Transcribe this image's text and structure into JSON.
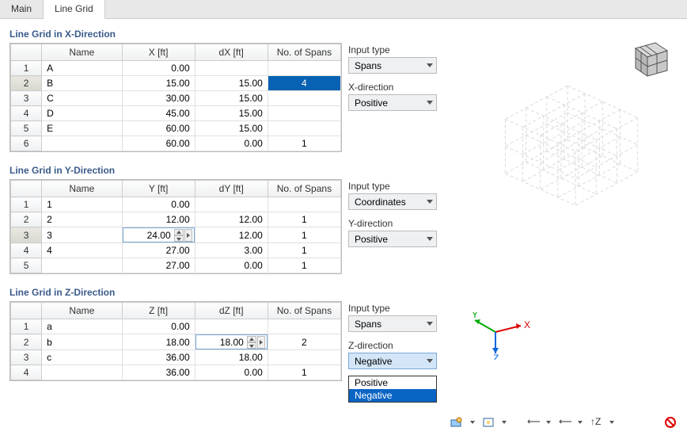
{
  "tabs": {
    "main": "Main",
    "linegrid": "Line Grid"
  },
  "sections": {
    "x": {
      "title": "Line Grid in X-Direction",
      "cols": [
        "Name",
        "X [ft]",
        "dX [ft]",
        "No. of Spans"
      ],
      "rows": [
        {
          "n": "1",
          "name": "A",
          "v": "0.00",
          "d": "",
          "s": ""
        },
        {
          "n": "2",
          "name": "B",
          "v": "15.00",
          "d": "15.00",
          "s": "4",
          "sel": true
        },
        {
          "n": "3",
          "name": "C",
          "v": "30.00",
          "d": "15.00",
          "s": ""
        },
        {
          "n": "4",
          "name": "D",
          "v": "45.00",
          "d": "15.00",
          "s": ""
        },
        {
          "n": "5",
          "name": "E",
          "v": "60.00",
          "d": "15.00",
          "s": ""
        },
        {
          "n": "6",
          "name": "",
          "v": "60.00",
          "d": "0.00",
          "s": "1"
        }
      ],
      "opts": {
        "input_lbl": "Input type",
        "input_val": "Spans",
        "dir_lbl": "X-direction",
        "dir_val": "Positive"
      }
    },
    "y": {
      "title": "Line Grid in Y-Direction",
      "cols": [
        "Name",
        "Y [ft]",
        "dY [ft]",
        "No. of Spans"
      ],
      "rows": [
        {
          "n": "1",
          "name": "1",
          "v": "0.00",
          "d": "",
          "s": ""
        },
        {
          "n": "2",
          "name": "2",
          "v": "12.00",
          "d": "12.00",
          "s": "1"
        },
        {
          "n": "3",
          "name": "3",
          "v": "24.00",
          "d": "12.00",
          "s": "1",
          "spin": true
        },
        {
          "n": "4",
          "name": "4",
          "v": "27.00",
          "d": "3.00",
          "s": "1"
        },
        {
          "n": "5",
          "name": "",
          "v": "27.00",
          "d": "0.00",
          "s": "1"
        }
      ],
      "opts": {
        "input_lbl": "Input type",
        "input_val": "Coordinates",
        "dir_lbl": "Y-direction",
        "dir_val": "Positive"
      }
    },
    "z": {
      "title": "Line Grid in Z-Direction",
      "cols": [
        "Name",
        "Z [ft]",
        "dZ [ft]",
        "No. of Spans"
      ],
      "rows": [
        {
          "n": "1",
          "name": "a",
          "v": "0.00",
          "d": "",
          "s": ""
        },
        {
          "n": "2",
          "name": "b",
          "v": "18.00",
          "d": "18.00",
          "s": "2",
          "spin_d": true
        },
        {
          "n": "3",
          "name": "c",
          "v": "36.00",
          "d": "18.00",
          "s": ""
        },
        {
          "n": "4",
          "name": "",
          "v": "36.00",
          "d": "0.00",
          "s": "1"
        }
      ],
      "opts": {
        "input_lbl": "Input type",
        "input_val": "Spans",
        "dir_lbl": "Z-direction",
        "dir_val": "Negative",
        "open": true,
        "options": [
          "Positive",
          "Negative"
        ]
      }
    }
  },
  "axes": {
    "x": "X",
    "y": "Y",
    "z": "Z"
  },
  "toolbar": [
    "view-mode-icon",
    "dd",
    "show-grid-icon",
    "dd",
    "sep",
    "x-axis-icon",
    "dd",
    "y-axis-icon",
    "dd",
    "z-axis-icon",
    "dd",
    "sep",
    "reset-icon"
  ]
}
